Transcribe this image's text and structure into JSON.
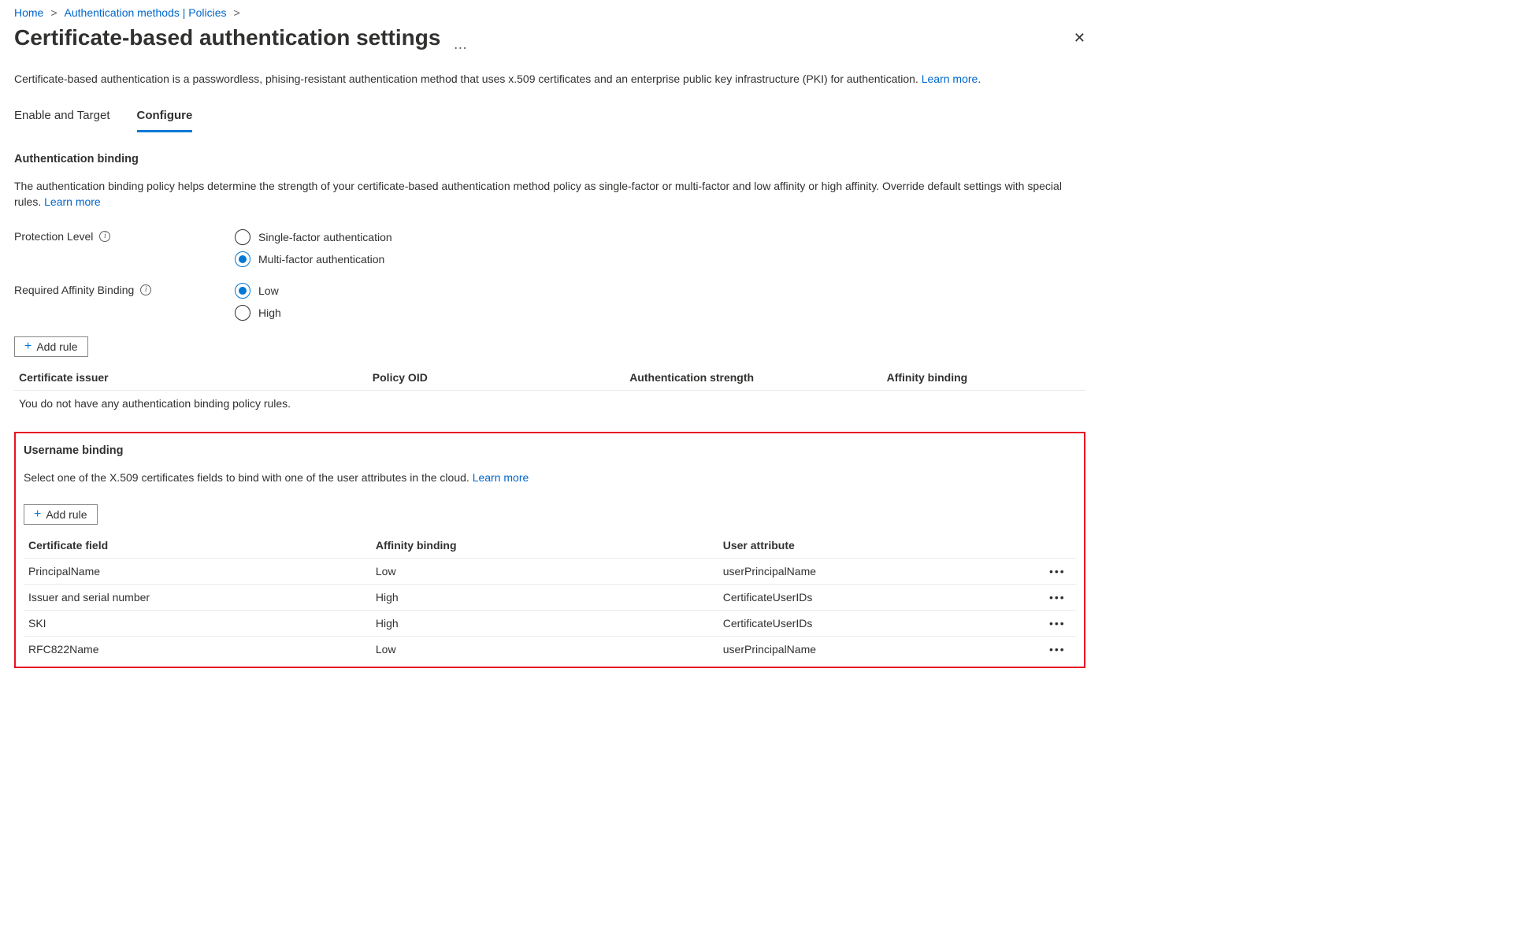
{
  "breadcrumb": {
    "home": "Home",
    "auth_methods": "Authentication methods | Policies"
  },
  "title": "Certificate-based authentication settings",
  "description": "Certificate-based authentication is a passwordless, phising-resistant authentication method that uses x.509 certificates and an enterprise public key infrastructure (PKI) for authentication. ",
  "learn_more": "Learn more",
  "tabs": {
    "enable": "Enable and Target",
    "configure": "Configure"
  },
  "auth_binding": {
    "heading": "Authentication binding",
    "desc": "The authentication binding policy helps determine the strength of your certificate-based authentication method policy as single-factor or multi-factor and low affinity or high affinity. Override default settings with special rules.  ",
    "protection_label": "Protection Level",
    "protection_options": {
      "single": "Single-factor authentication",
      "multi": "Multi-factor authentication"
    },
    "affinity_label": "Required Affinity Binding",
    "affinity_options": {
      "low": "Low",
      "high": "High"
    },
    "add_rule": "Add rule",
    "columns": {
      "issuer": "Certificate issuer",
      "oid": "Policy OID",
      "strength": "Authentication strength",
      "affinity": "Affinity binding"
    },
    "empty": "You do not have any authentication binding policy rules."
  },
  "username_binding": {
    "heading": "Username binding",
    "desc": "Select one of the X.509 certificates fields to bind with one of the user attributes in the cloud.  ",
    "add_rule": "Add rule",
    "columns": {
      "field": "Certificate field",
      "affinity": "Affinity binding",
      "attr": "User attribute"
    },
    "rows": [
      {
        "field": "PrincipalName",
        "affinity": "Low",
        "attr": "userPrincipalName"
      },
      {
        "field": "Issuer and serial number",
        "affinity": "High",
        "attr": "CertificateUserIDs"
      },
      {
        "field": "SKI",
        "affinity": "High",
        "attr": "CertificateUserIDs"
      },
      {
        "field": "RFC822Name",
        "affinity": "Low",
        "attr": "userPrincipalName"
      }
    ]
  }
}
